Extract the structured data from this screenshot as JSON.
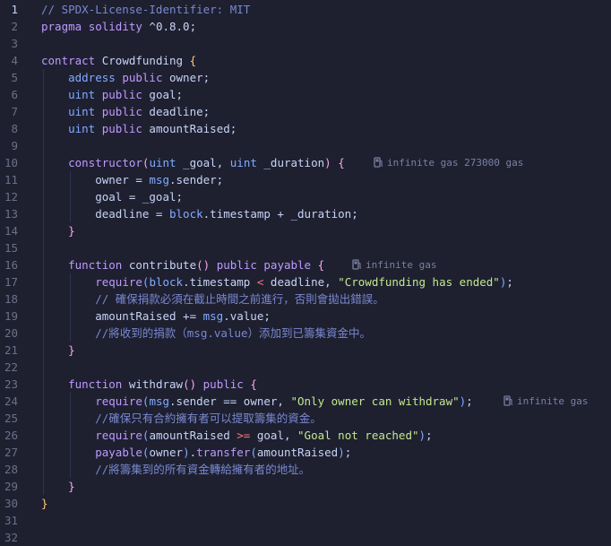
{
  "editor": {
    "language": "solidity",
    "colors": {
      "background": "#1e2030",
      "comment": "#7a88cf",
      "keyword": "#c099ff",
      "type": "#82aaff",
      "string": "#c3e88d",
      "hint": "#7a80a0"
    },
    "line_numbers": [
      "1",
      "2",
      "3",
      "4",
      "5",
      "6",
      "7",
      "8",
      "9",
      "10",
      "11",
      "12",
      "13",
      "14",
      "15",
      "16",
      "17",
      "18",
      "19",
      "20",
      "21",
      "22",
      "23",
      "24",
      "25",
      "26",
      "27",
      "28",
      "29",
      "30",
      "31",
      "32"
    ],
    "lines": [
      [
        [
          "cm",
          "// SPDX-License-Identifier: MIT"
        ]
      ],
      [
        [
          "kw",
          "pragma"
        ],
        [
          "op",
          " "
        ],
        [
          "kw",
          "solidity"
        ],
        [
          "op",
          " ^0.8.0;"
        ]
      ],
      [],
      [
        [
          "kw",
          "contract"
        ],
        [
          "op",
          " Crowdfunding "
        ],
        [
          "yb",
          "{"
        ]
      ],
      [
        [
          "op",
          "    "
        ],
        [
          "ty",
          "address"
        ],
        [
          "op",
          " "
        ],
        [
          "kw",
          "public"
        ],
        [
          "op",
          " owner;"
        ]
      ],
      [
        [
          "op",
          "    "
        ],
        [
          "ty",
          "uint"
        ],
        [
          "op",
          " "
        ],
        [
          "kw",
          "public"
        ],
        [
          "op",
          " goal;"
        ]
      ],
      [
        [
          "op",
          "    "
        ],
        [
          "ty",
          "uint"
        ],
        [
          "op",
          " "
        ],
        [
          "kw",
          "public"
        ],
        [
          "op",
          " deadline;"
        ]
      ],
      [
        [
          "op",
          "    "
        ],
        [
          "ty",
          "uint"
        ],
        [
          "op",
          " "
        ],
        [
          "kw",
          "public"
        ],
        [
          "op",
          " amountRaised;"
        ]
      ],
      [],
      [
        [
          "op",
          "    "
        ],
        [
          "kw",
          "constructor"
        ],
        [
          "pb",
          "("
        ],
        [
          "ty",
          "uint"
        ],
        [
          "op",
          " _goal, "
        ],
        [
          "ty",
          "uint"
        ],
        [
          "op",
          " _duration"
        ],
        [
          "pb",
          ")"
        ],
        [
          "op",
          " "
        ],
        [
          "pb",
          "{"
        ]
      ],
      [
        [
          "op",
          "        owner = "
        ],
        [
          "ty",
          "msg"
        ],
        [
          "op",
          ".sender;"
        ]
      ],
      [
        [
          "op",
          "        goal = _goal;"
        ]
      ],
      [
        [
          "op",
          "        deadline = "
        ],
        [
          "ty",
          "block"
        ],
        [
          "op",
          ".timestamp + _duration;"
        ]
      ],
      [
        [
          "op",
          "    "
        ],
        [
          "pb",
          "}"
        ]
      ],
      [],
      [
        [
          "op",
          "    "
        ],
        [
          "kw",
          "function"
        ],
        [
          "op",
          " contribute"
        ],
        [
          "pb",
          "()"
        ],
        [
          "op",
          " "
        ],
        [
          "kw",
          "public"
        ],
        [
          "op",
          " "
        ],
        [
          "kw",
          "payable"
        ],
        [
          "op",
          " "
        ],
        [
          "pb",
          "{"
        ]
      ],
      [
        [
          "op",
          "        "
        ],
        [
          "kw",
          "require"
        ],
        [
          "bb",
          "("
        ],
        [
          "ty",
          "block"
        ],
        [
          "op",
          ".timestamp "
        ],
        [
          "rd",
          "<"
        ],
        [
          "op",
          " deadline, "
        ],
        [
          "st",
          "\"Crowdfunding has ended\""
        ],
        [
          "bb",
          ")"
        ],
        [
          "op",
          ";"
        ]
      ],
      [
        [
          "op",
          "        "
        ],
        [
          "cm",
          "// 確保捐款必須在截止時間之前進行，否則會拋出錯誤。"
        ]
      ],
      [
        [
          "op",
          "        amountRaised += "
        ],
        [
          "ty",
          "msg"
        ],
        [
          "op",
          ".value;"
        ]
      ],
      [
        [
          "op",
          "        "
        ],
        [
          "cm",
          "//將收到的捐款（msg.value）添加到已籌集資金中。"
        ]
      ],
      [
        [
          "op",
          "    "
        ],
        [
          "pb",
          "}"
        ]
      ],
      [],
      [
        [
          "op",
          "    "
        ],
        [
          "kw",
          "function"
        ],
        [
          "op",
          " withdraw"
        ],
        [
          "pb",
          "()"
        ],
        [
          "op",
          " "
        ],
        [
          "kw",
          "public"
        ],
        [
          "op",
          " "
        ],
        [
          "pb",
          "{"
        ]
      ],
      [
        [
          "op",
          "        "
        ],
        [
          "kw",
          "require"
        ],
        [
          "bb",
          "("
        ],
        [
          "ty",
          "msg"
        ],
        [
          "op",
          ".sender == owner, "
        ],
        [
          "st",
          "\"Only owner can withdraw\""
        ],
        [
          "bb",
          ")"
        ],
        [
          "op",
          ";"
        ]
      ],
      [
        [
          "op",
          "        "
        ],
        [
          "cm",
          "//確保只有合約擁有者可以提取籌集的資金。"
        ]
      ],
      [
        [
          "op",
          "        "
        ],
        [
          "kw",
          "require"
        ],
        [
          "bb",
          "("
        ],
        [
          "op",
          "amountRaised "
        ],
        [
          "rd",
          ">="
        ],
        [
          "op",
          " goal, "
        ],
        [
          "st",
          "\"Goal not reached\""
        ],
        [
          "bb",
          ")"
        ],
        [
          "op",
          ";"
        ]
      ],
      [
        [
          "op",
          "        "
        ],
        [
          "kw",
          "payable"
        ],
        [
          "bb",
          "("
        ],
        [
          "op",
          "owner"
        ],
        [
          "bb",
          ")"
        ],
        [
          "op",
          "."
        ],
        [
          "kw",
          "transfer"
        ],
        [
          "bb",
          "("
        ],
        [
          "op",
          "amountRaised"
        ],
        [
          "bb",
          ")"
        ],
        [
          "op",
          ";"
        ]
      ],
      [
        [
          "op",
          "        "
        ],
        [
          "cm",
          "//將籌集到的所有資金轉給擁有者的地址。"
        ]
      ],
      [
        [
          "op",
          "    "
        ],
        [
          "pb",
          "}"
        ]
      ],
      [
        [
          "yb",
          "}"
        ]
      ],
      [],
      []
    ],
    "hints": [
      {
        "line": 10,
        "text": "infinite gas 273000 gas",
        "icon": "gas-pump-icon"
      },
      {
        "line": 16,
        "text": "infinite gas",
        "icon": "gas-pump-icon"
      },
      {
        "line": 24,
        "text": "infinite gas",
        "icon": "gas-pump-icon"
      }
    ]
  }
}
